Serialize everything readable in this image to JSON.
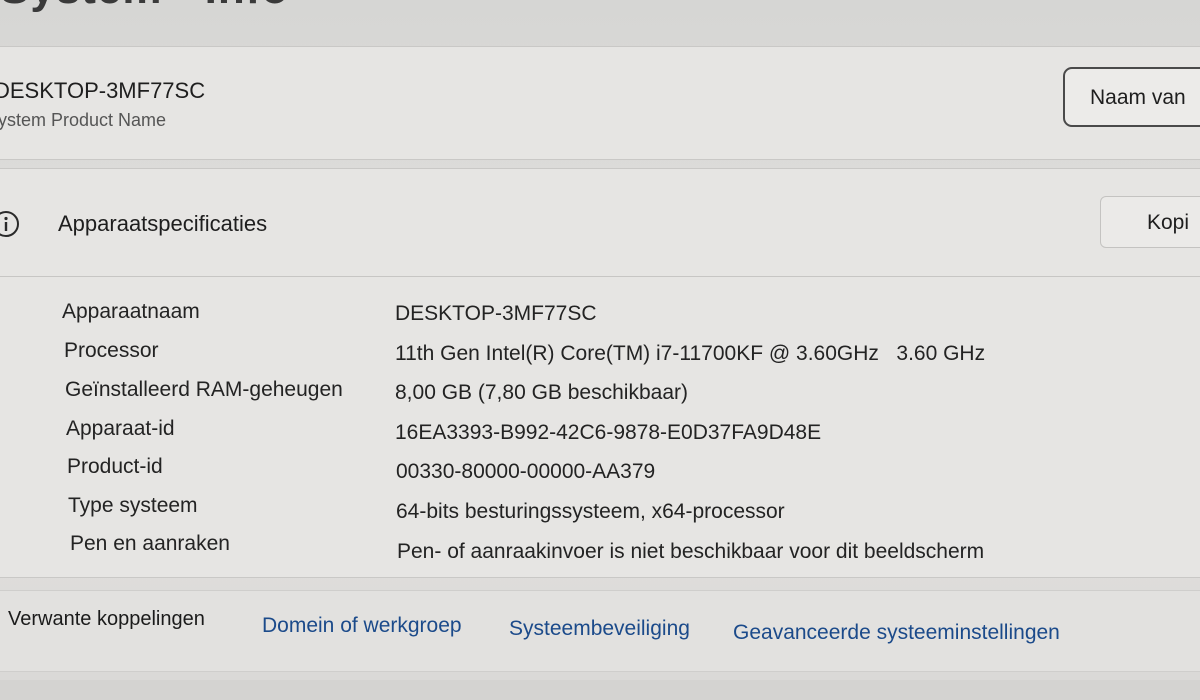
{
  "page": {
    "heading": "System - Info"
  },
  "device": {
    "name": "DESKTOP-3MF77SC",
    "product_name": "ystem Product Name",
    "rename_label": "Naam van"
  },
  "specs": {
    "title": "Apparaatspecificaties",
    "copy_label": "Kopi",
    "icon": "info-icon",
    "rows": [
      {
        "label": "Apparaatnaam",
        "value": "DESKTOP-3MF77SC"
      },
      {
        "label": "Processor",
        "value": "11th Gen Intel(R) Core(TM) i7-11700KF @ 3.60GHz   3.60 GHz"
      },
      {
        "label": "Geïnstalleerd RAM-geheugen",
        "value": "8,00 GB (7,80 GB beschikbaar)"
      },
      {
        "label": "Apparaat-id",
        "value": "16EA3393-B992-42C6-9878-E0D37FA9D48E"
      },
      {
        "label": "Product-id",
        "value": "00330-80000-00000-AA379"
      },
      {
        "label": "Type systeem",
        "value": "64-bits besturingssysteem, x64-processor"
      },
      {
        "label": "Pen en aanraken",
        "value": "Pen- of aanraakinvoer is niet beschikbaar voor dit beeldscherm"
      }
    ]
  },
  "related_links": {
    "heading": "Verwante koppelingen",
    "links": [
      {
        "label": "Domein of werkgroep"
      },
      {
        "label": "Systeembeveiliging"
      },
      {
        "label": "Geavanceerde systeeminstellingen"
      }
    ]
  },
  "colors": {
    "link": "#1b4a8a",
    "background": "#dcdcda"
  }
}
